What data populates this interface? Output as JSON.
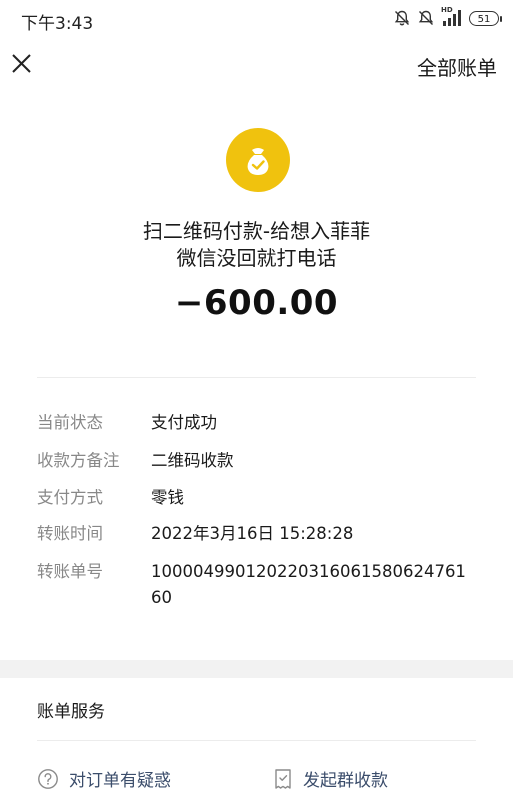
{
  "status_bar": {
    "time": "下午3:43",
    "network": "HD",
    "battery": "51"
  },
  "nav": {
    "close_icon": "close-icon",
    "all_bills": "全部账单"
  },
  "transaction": {
    "icon": "money-bag-check-icon",
    "icon_color": "#f0c20e",
    "title_line1": "扫二维码付款-给想入菲菲",
    "title_line2": "微信没回就打电话",
    "amount": "−600.00"
  },
  "details": [
    {
      "label": "当前状态",
      "value": "支付成功"
    },
    {
      "label": "收款方备注",
      "value": "二维码收款"
    },
    {
      "label": "支付方式",
      "value": "零钱"
    },
    {
      "label": "转账时间",
      "value": "2022年3月16日 15:28:28"
    },
    {
      "label": "转账单号",
      "value": "100004990120220316061580624761​60"
    }
  ],
  "services": {
    "title": "账单服务",
    "items": [
      {
        "icon": "question-circle-icon",
        "label": "对订单有疑惑"
      },
      {
        "icon": "receipt-icon",
        "label": "发起群收款"
      }
    ],
    "link_color": "#3b4d6b"
  }
}
